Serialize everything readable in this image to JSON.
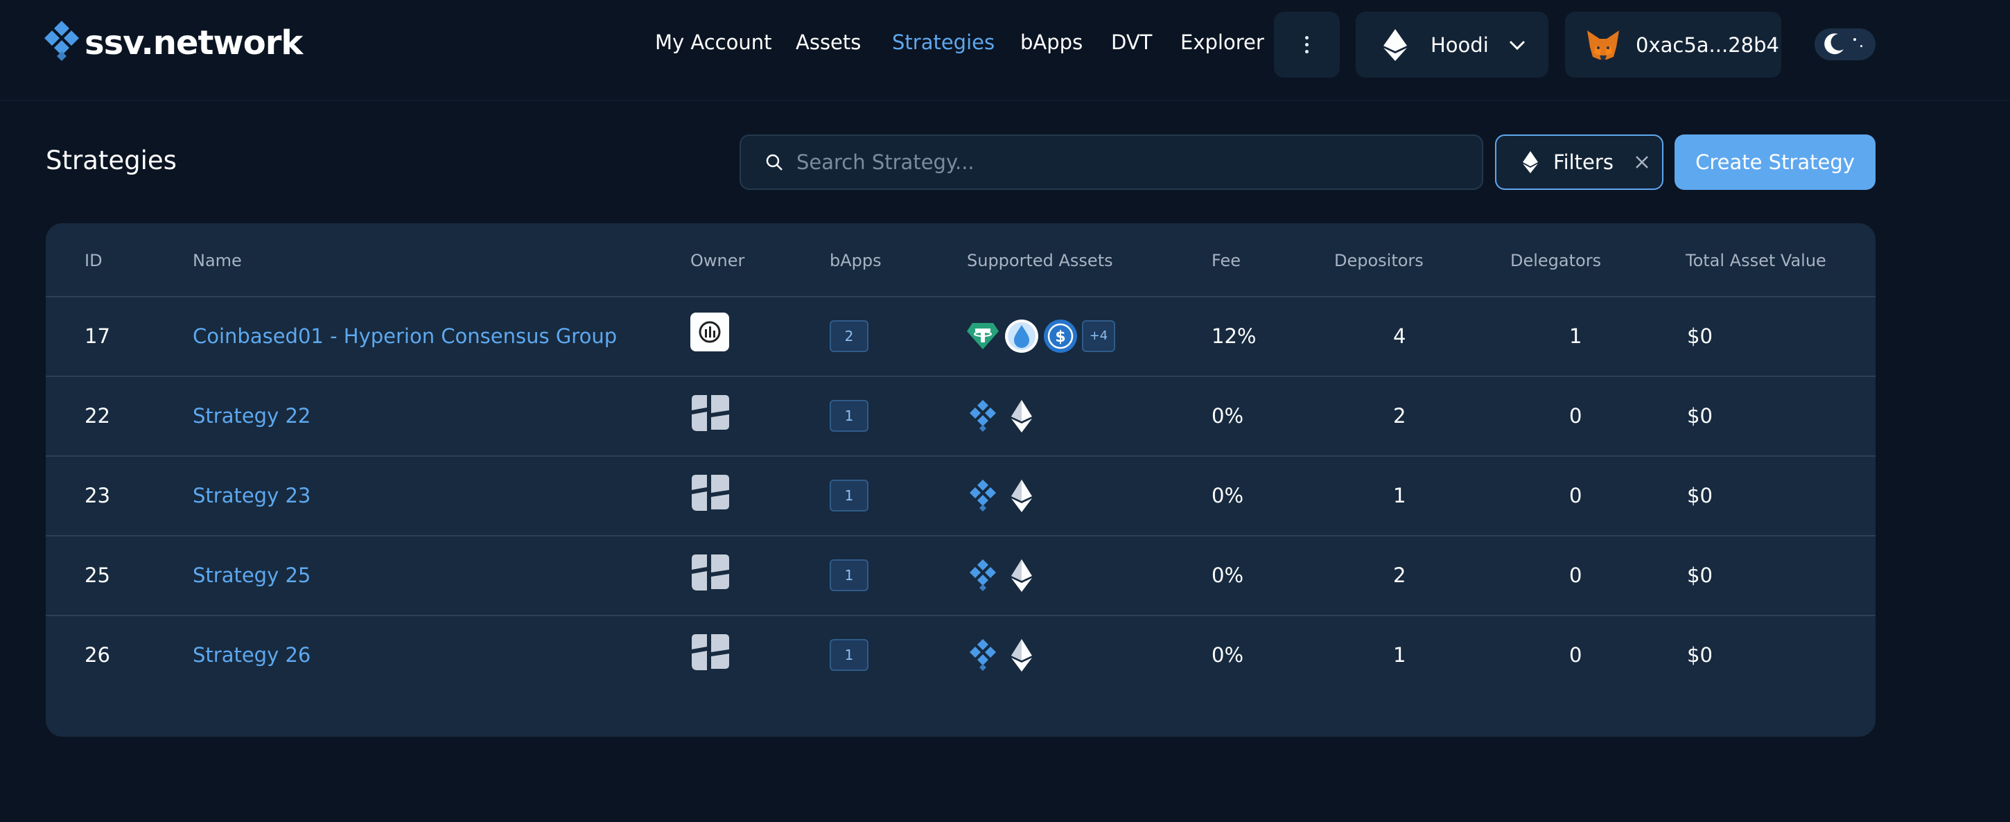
{
  "brand": {
    "logo_text": "ssv.network"
  },
  "nav": {
    "items": [
      {
        "label": "My Account",
        "active": false
      },
      {
        "label": "Assets",
        "active": false
      },
      {
        "label": "Strategies",
        "active": true
      },
      {
        "label": "bApps",
        "active": false
      },
      {
        "label": "DVT",
        "active": false
      },
      {
        "label": "Explorer",
        "active": false
      }
    ],
    "network": "Hoodi",
    "wallet_address": "0xac5a...28b4"
  },
  "toolbar": {
    "title": "Strategies",
    "search_placeholder": "Search Strategy...",
    "filters_label": "Filters",
    "create_label": "Create Strategy"
  },
  "table": {
    "columns": [
      "ID",
      "Name",
      "Owner",
      "bApps",
      "Supported Assets",
      "Fee",
      "Depositors",
      "Delegators",
      "Total Asset Value"
    ],
    "rows": [
      {
        "id": "17",
        "name": "Coinbased01 - Hyperion Consensus Group",
        "owner_icon": "hyperion-avatar-icon",
        "bapps": "2",
        "assets": [
          "tether-icon",
          "lido-drop-icon",
          "usdc-icon"
        ],
        "assets_more": "+4",
        "fee": "12%",
        "depositors": "4",
        "delegators": "1",
        "total_value": "$0"
      },
      {
        "id": "22",
        "name": "Strategy 22",
        "owner_icon": "default-avatar-icon",
        "bapps": "1",
        "assets": [
          "ssv-icon",
          "eth-icon"
        ],
        "assets_more": "",
        "fee": "0%",
        "depositors": "2",
        "delegators": "0",
        "total_value": "$0"
      },
      {
        "id": "23",
        "name": "Strategy 23",
        "owner_icon": "default-avatar-icon",
        "bapps": "1",
        "assets": [
          "ssv-icon",
          "eth-icon"
        ],
        "assets_more": "",
        "fee": "0%",
        "depositors": "1",
        "delegators": "0",
        "total_value": "$0"
      },
      {
        "id": "25",
        "name": "Strategy 25",
        "owner_icon": "default-avatar-icon",
        "bapps": "1",
        "assets": [
          "ssv-icon",
          "eth-icon"
        ],
        "assets_more": "",
        "fee": "0%",
        "depositors": "2",
        "delegators": "0",
        "total_value": "$0"
      },
      {
        "id": "26",
        "name": "Strategy 26",
        "owner_icon": "default-avatar-icon",
        "bapps": "1",
        "assets": [
          "ssv-icon",
          "eth-icon"
        ],
        "assets_more": "",
        "fee": "0%",
        "depositors": "1",
        "delegators": "0",
        "total_value": "$0"
      }
    ]
  },
  "colors": {
    "accent": "#5ea8ef",
    "background": "#0b1422",
    "card": "#172a3f"
  }
}
